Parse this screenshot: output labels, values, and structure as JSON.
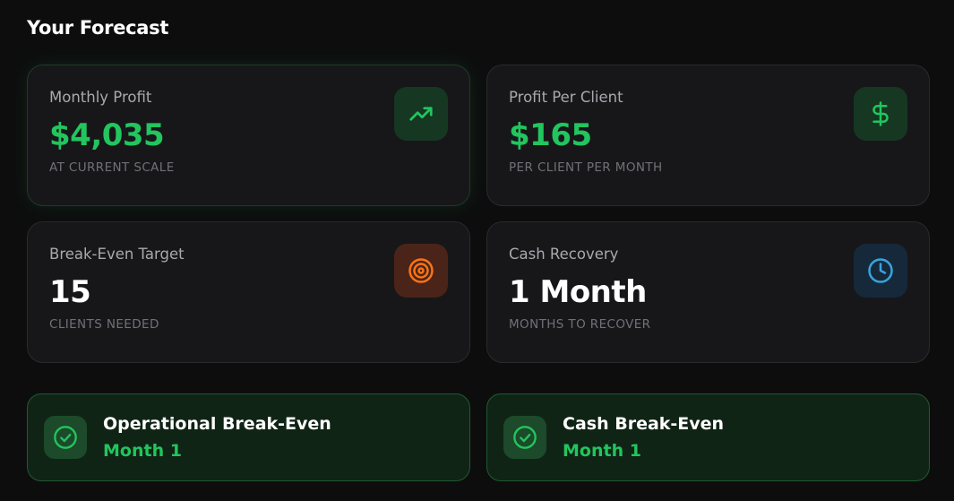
{
  "page": {
    "title": "Your Forecast"
  },
  "cards": {
    "monthly_profit": {
      "label": "Monthly Profit",
      "value": "$4,035",
      "sub": "AT CURRENT SCALE",
      "icon": "trending-up-icon"
    },
    "profit_per_client": {
      "label": "Profit Per Client",
      "value": "$165",
      "sub": "PER CLIENT PER MONTH",
      "icon": "dollar-icon"
    },
    "break_even_target": {
      "label": "Break-Even Target",
      "value": "15",
      "sub": "CLIENTS NEEDED",
      "icon": "target-icon"
    },
    "cash_recovery": {
      "label": "Cash Recovery",
      "value": "1 Month",
      "sub": "MONTHS TO RECOVER",
      "icon": "clock-icon"
    }
  },
  "banners": {
    "operational": {
      "title": "Operational Break-Even",
      "value": "Month 1",
      "icon": "check-circle-icon"
    },
    "cash": {
      "title": "Cash Break-Even",
      "value": "Month 1",
      "icon": "check-circle-icon"
    }
  },
  "colors": {
    "accent_green": "#22c55e",
    "accent_orange": "#f97316",
    "accent_blue": "#38a3e0",
    "card_bg": "#17171a",
    "page_bg": "#0d0d0e"
  }
}
